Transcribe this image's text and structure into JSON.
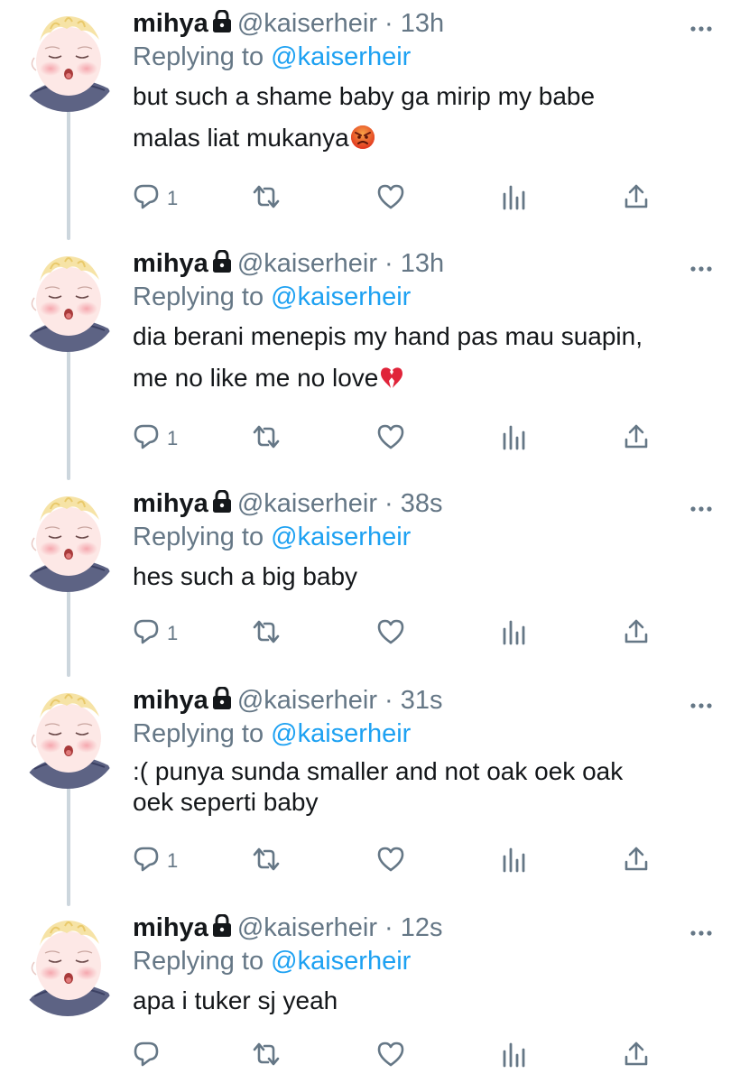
{
  "user": {
    "name": "mihya",
    "handle": "@kaiserheir",
    "separator": "·",
    "replying_prefix": "Replying to",
    "replying_to": "@kaiserheir"
  },
  "tweets": [
    {
      "time": "13h",
      "text": "but such a shame baby ga mirip my babe\nmalas liat mukanya",
      "emoji": "angry-face",
      "reply_count": "1"
    },
    {
      "time": "13h",
      "text": "dia berani menepis my hand pas mau suapin,\nme no like me no love",
      "emoji": "broken-heart",
      "reply_count": "1"
    },
    {
      "time": "38s",
      "text": "hes such a big baby",
      "emoji": "",
      "reply_count": "1"
    },
    {
      "time": "31s",
      "text": ":( punya sunda smaller and not oak oek oak\noek seperti baby",
      "emoji": "",
      "reply_count": "1"
    },
    {
      "time": "12s",
      "text": "apa i tuker sj yeah",
      "emoji": "",
      "reply_count": ""
    }
  ],
  "colors": {
    "text": "#14171a",
    "secondary": "#657786",
    "link": "#1da1f2",
    "thread_line": "#ccd6dd"
  },
  "icons": [
    "lock-icon",
    "more-icon",
    "reply-icon",
    "retweet-icon",
    "like-icon",
    "analytics-icon",
    "share-icon",
    "angry-face-emoji",
    "broken-heart-emoji"
  ]
}
